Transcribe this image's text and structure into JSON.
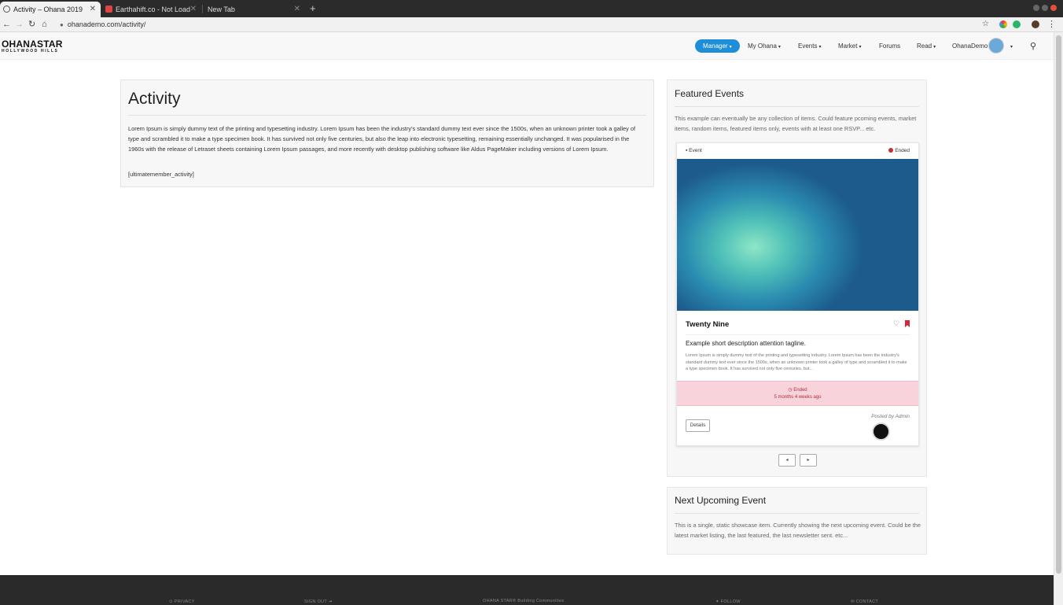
{
  "browser": {
    "tabs": [
      {
        "title": "Activity – Ohana 2019",
        "active": true
      },
      {
        "title": "Earthahift.co - Not Load",
        "active": false
      },
      {
        "title": "New Tab",
        "active": false
      }
    ],
    "new_tab_label": "+",
    "url": "ohanademo.com/activity/"
  },
  "site": {
    "logo_main": "OHANASTAR",
    "logo_sub": "HOLLYWOOD HILLS",
    "nav": {
      "manager": "Manager",
      "my_ohana": "My Ohana",
      "events": "Events",
      "market": "Market",
      "forums": "Forums",
      "read": "Read",
      "user": "OhanaDemo"
    }
  },
  "main": {
    "title": "Activity",
    "body": "Lorem Ipsum is simply dummy text of the printing and typesetting industry. Lorem Ipsum has been the industry's standard dummy text ever since the 1500s, when an unknown printer took a galley of type and scrambled it to make a type specimen book. It has survived not only five centuries, but also the leap into electronic typesetting, remaining essentially unchanged. It was popularised in the 1960s with the release of Letraset sheets containing Lorem Ipsum passages, and more recently with desktop publishing software like Aldus PageMaker including versions of Lorem Ipsum.",
    "shortcode": "[ultimatemember_activity]"
  },
  "featured": {
    "title": "Featured Events",
    "description": "This example can eventually be any collection of items. Could feature pcoming events, market items, random items, featured items only, events with at least one RSVP... etc.",
    "card": {
      "type_label": "Event",
      "status_label": "Ended",
      "title": "Twenty Nine",
      "tagline": "Example short description attention tagline.",
      "excerpt": "Lorem Ipsum is simply dummy text of the printing and typesetting industry. Lorem Ipsum has been the industry's standard dummy text ever since the 1500s, when an unknown printer took a galley of type and scrambled it to make a type specimen book. It has survived not only five centuries, but...",
      "ended_label": "Ended",
      "ended_ago": "5 months 4 weeks ago",
      "posted_by": "Posted by Admin",
      "details_label": "Details"
    },
    "prev_label": "◂",
    "next_label": "▸"
  },
  "next_upcoming": {
    "title": "Next Upcoming Event",
    "description": "This is a single, static showcase item. Currently showing the next upcoming event. Could be the latest market listing, the last featured, the last newsletter sent. etc..."
  },
  "footer": {
    "privacy": "PRIVACY",
    "sign_out": "SIGN OUT",
    "brand": "OHANA STAR® Building Communities",
    "follow": "FOLLOW",
    "contact": "CONTACT"
  },
  "colors": {
    "accent": "#1f8ed8",
    "ended_bg": "#f8d3dc",
    "bookmark": "#d3263a",
    "footer_bg": "#2a2a2a"
  }
}
